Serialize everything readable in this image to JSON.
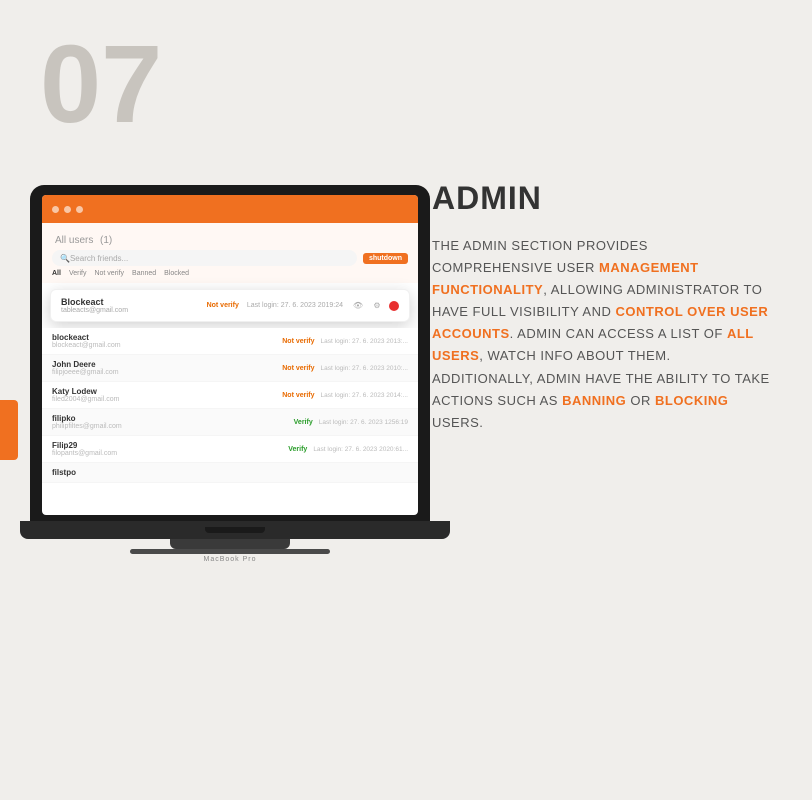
{
  "page": {
    "number": "07",
    "background_color": "#f0eeeb"
  },
  "title": {
    "label": "ADMIN"
  },
  "description": {
    "part1": "THE ADMIN SECTION PROVIDES COMPREHENSIVE USER ",
    "highlight1": "MANAGEMENT FUNCTIONALITY",
    "part2": ", ALLOWING ADMINISTRATOR TO HAVE FULL VISIBILITY AND ",
    "highlight2": "CONTROL OVER USER ACCOUNTS",
    "part3": ". ADMIN CAN ACCESS A LIST OF ",
    "highlight3": "ALL USERS",
    "part4": ", WATCH INFO ABOUT THEM. ADDITIONALLY, ADMIN HAVE THE ABILITY TO TAKE ACTIONS SUCH AS ",
    "highlight4": "BANNING",
    "part5": " OR ",
    "highlight5": "BLOCKING",
    "part6": " USERS."
  },
  "laptop": {
    "brand": "MacBook Pro"
  },
  "screen": {
    "all_users_label": "All users",
    "user_count": "(1)",
    "search_placeholder": "Search friends...",
    "shutdown_btn": "shutdown",
    "filter_tabs": [
      "All",
      "Verify",
      "Not verify",
      "Banned",
      "Blocked"
    ],
    "active_filter": "All"
  },
  "popup_user": {
    "name": "Blockeact",
    "email": "tableacts@gmail.com",
    "status": "Not verify",
    "last_login": "Last login: 27. 6. 2023 2019:24"
  },
  "users": [
    {
      "name": "blockeact",
      "email": "blockeact@gmail.com",
      "status": "Not verify",
      "last_login": "Last login: 27. 6. 2023 2013:..."
    },
    {
      "name": "John Deere",
      "email": "filipjoeee@gmail.com",
      "status": "Not verify",
      "last_login": "Last login: 27. 6. 2023 2010:..."
    },
    {
      "name": "Katy Lodew",
      "email": "filed2004@gmail.com",
      "status": "Not verify",
      "last_login": "Last login: 27. 6. 2023 2014:..."
    },
    {
      "name": "filipko",
      "email": "philipfiltes@gmail.com",
      "status": "Verify",
      "last_login": "Last login: 27. 6. 2023 1256:19"
    },
    {
      "name": "Filip29",
      "email": "filopants@gmail.com",
      "status": "Verify",
      "last_login": "Last login: 27. 6. 2023 2020:61..."
    },
    {
      "name": "filstpo",
      "email": "",
      "status": "",
      "last_login": ""
    }
  ],
  "orange_accent": true
}
